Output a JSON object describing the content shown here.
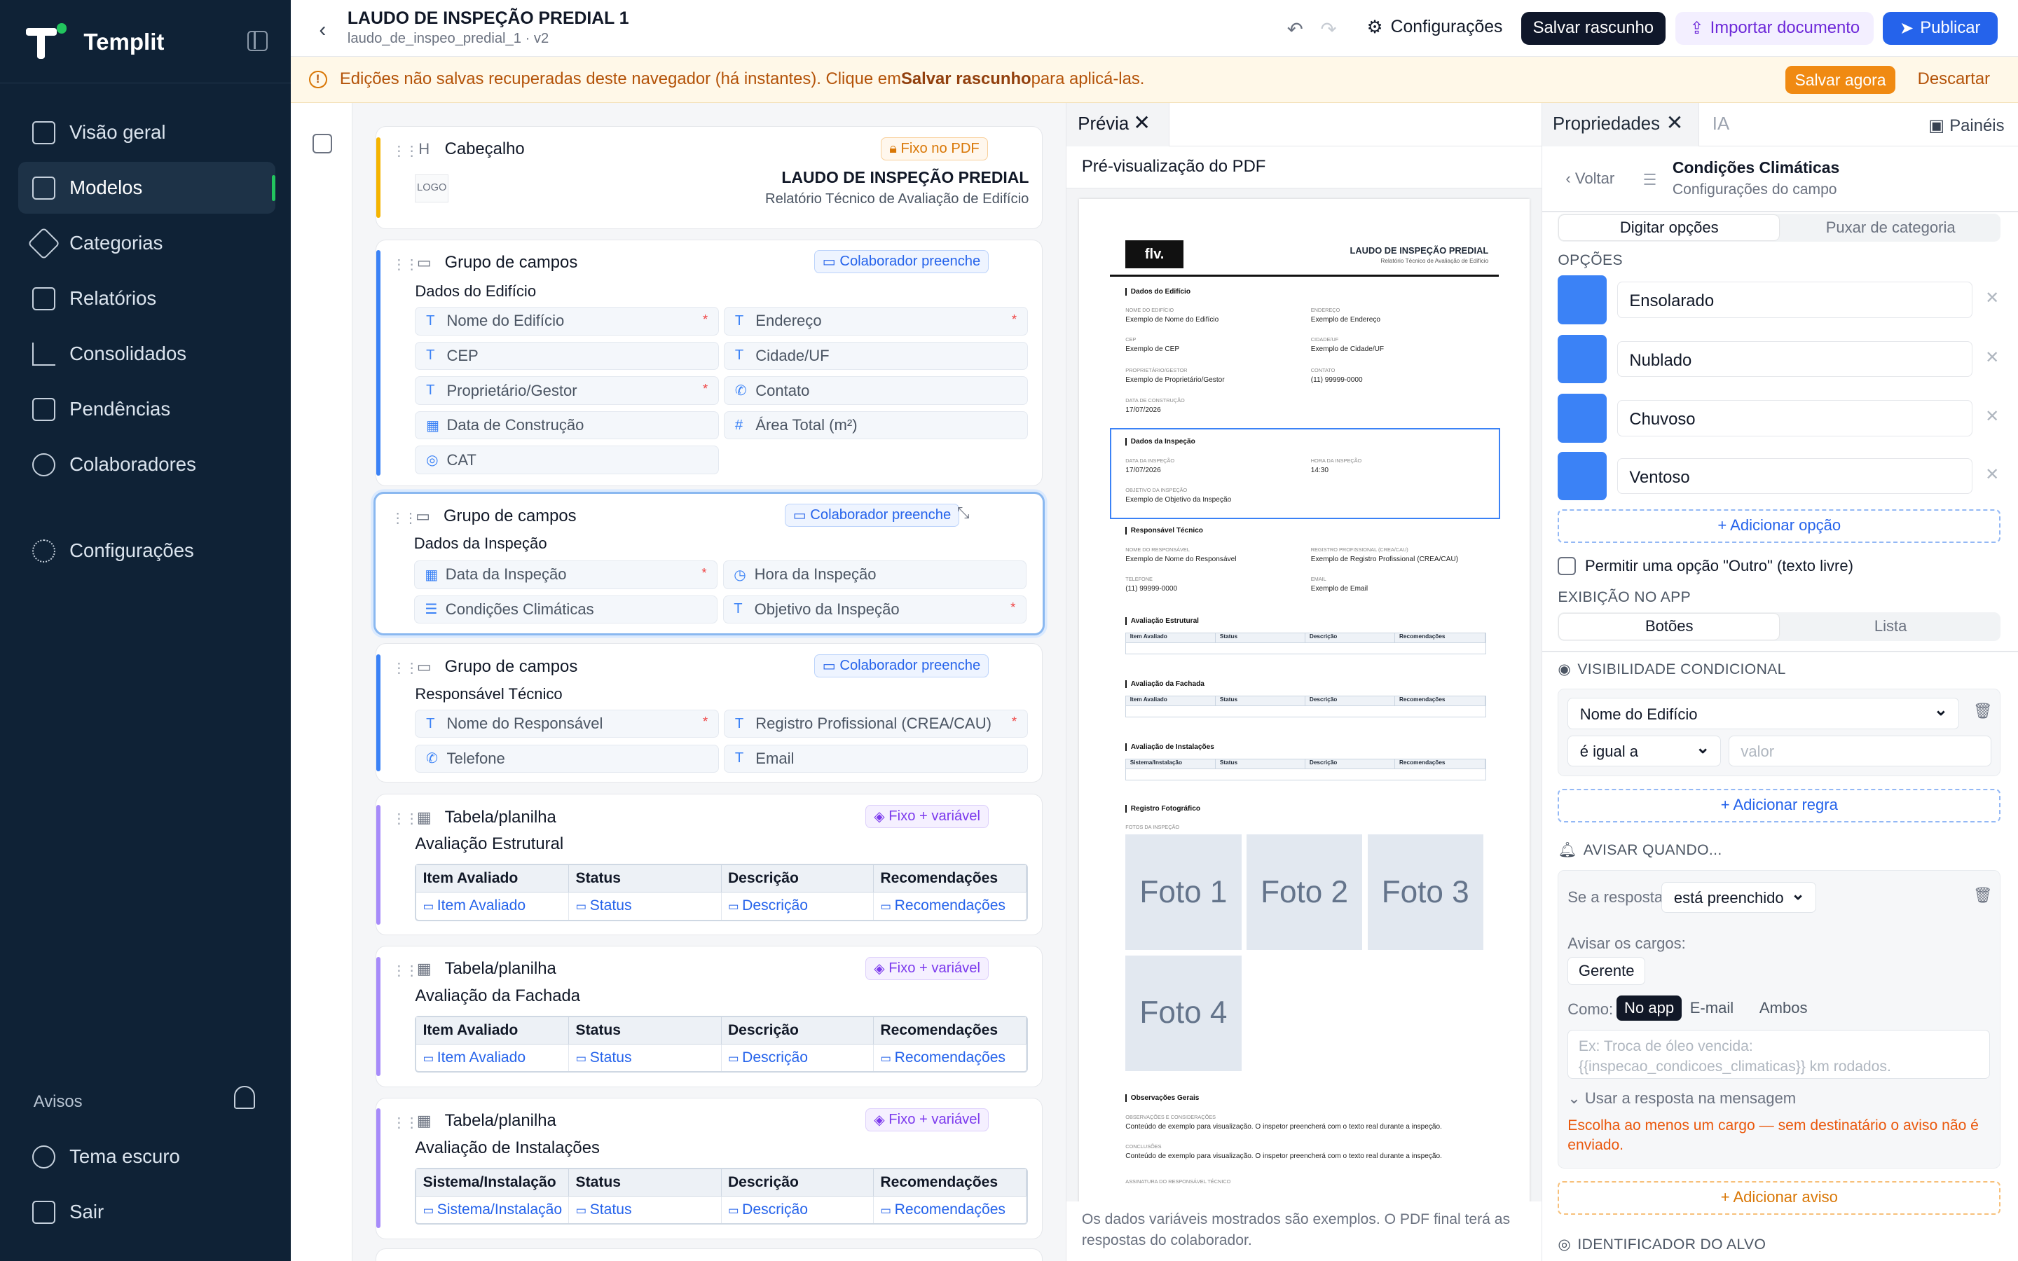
{
  "app": {
    "name": "Templit"
  },
  "sidebar": {
    "items": [
      {
        "label": "Visão geral",
        "icon": "grid-icon"
      },
      {
        "label": "Modelos",
        "icon": "document-icon",
        "active": true
      },
      {
        "label": "Categorias",
        "icon": "tag-icon"
      },
      {
        "label": "Relatórios",
        "icon": "building-icon"
      },
      {
        "label": "Consolidados",
        "icon": "bar-chart-icon"
      },
      {
        "label": "Pendências",
        "icon": "lock-icon"
      },
      {
        "label": "Colaboradores",
        "icon": "users-icon"
      }
    ],
    "settings": "Configurações",
    "notices": "Avisos",
    "dark_theme": "Tema escuro",
    "logout": "Sair"
  },
  "header": {
    "title": "LAUDO DE INSPEÇÃO PREDIAL 1",
    "subtitle": "laudo_de_inspeo_predial_1 · v2",
    "settings": "Configurações",
    "save_draft": "Salvar rascunho",
    "import": "Importar documento",
    "publish": "Publicar"
  },
  "banner": {
    "text1": "Edições não salvas recuperadas deste navegador (há instantes). Clique em ",
    "bold": "Salvar rascunho",
    "text2": " para aplicá-las.",
    "save_now": "Salvar agora",
    "discard": "Descartar"
  },
  "canvas": {
    "header_block": {
      "label": "Cabeçalho",
      "tag": "Fixo no PDF",
      "logo": "LOGO",
      "title": "LAUDO DE INSPEÇÃO PREDIAL",
      "subtitle": "Relatório Técnico de Avaliação de Edifício"
    },
    "groups": [
      {
        "label": "Grupo de campos",
        "tag": "Colaborador preenche",
        "name": "Dados do Edifício",
        "fields": [
          "Nome do Edifício",
          "Endereço",
          "CEP",
          "Cidade/UF",
          "Proprietário/Gestor",
          "Contato",
          "Data de Construção",
          "Área Total (m²)",
          "CAT"
        ]
      },
      {
        "label": "Grupo de campos",
        "tag": "Colaborador preenche",
        "name": "Dados da Inspeção",
        "fields": [
          "Data da Inspeção",
          "Hora da Inspeção",
          "Condições Climáticas",
          "Objetivo da Inspeção"
        ]
      },
      {
        "label": "Grupo de campos",
        "tag": "Colaborador preenche",
        "name": "Responsável Técnico",
        "fields": [
          "Nome do Responsável",
          "Registro Profissional (CREA/CAU)",
          "Telefone",
          "Email"
        ]
      }
    ],
    "tables": [
      {
        "label": "Tabela/planilha",
        "tag": "Fixo + variável",
        "name": "Avaliação Estrutural",
        "headers": [
          "Item Avaliado",
          "Status",
          "Descrição",
          "Recomendações"
        ],
        "cells": [
          "Item Avaliado",
          "Status",
          "Descrição",
          "Recomendações"
        ]
      },
      {
        "label": "Tabela/planilha",
        "tag": "Fixo + variável",
        "name": "Avaliação da Fachada",
        "headers": [
          "Item Avaliado",
          "Status",
          "Descrição",
          "Recomendações"
        ],
        "cells": [
          "Item Avaliado",
          "Status",
          "Descrição",
          "Recomendações"
        ]
      },
      {
        "label": "Tabela/planilha",
        "tag": "Fixo + variável",
        "name": "Avaliação de Instalações",
        "headers": [
          "Sistema/Instalação",
          "Status",
          "Descrição",
          "Recomendações"
        ],
        "cells": [
          "Sistema/Instalação",
          "Status",
          "Descrição",
          "Recomendações"
        ]
      }
    ]
  },
  "preview": {
    "tab": "Prévia",
    "title": "Pré-visualização do PDF",
    "footer": "Os dados variáveis mostrados são exemplos. O PDF final terá as respostas do colaborador.",
    "pdf": {
      "logo": "flv.",
      "title": "LAUDO DE INSPEÇÃO PREDIAL",
      "subtitle": "Relatório Técnico de Avaliação de Edifício",
      "s1": "Dados do Edifício",
      "s2": "Dados da Inspeção",
      "s3": "Responsável Técnico",
      "s4": "Avaliação Estrutural",
      "s5": "Avaliação da Fachada",
      "s6": "Avaliação de Instalações",
      "s7": "Registro Fotográfico",
      "s8": "Observações Gerais",
      "l_nome": "NOME DO EDIFÍCIO",
      "v_nome": "Exemplo de Nome do Edifício",
      "l_end": "ENDEREÇO",
      "v_end": "Exemplo de Endereço",
      "l_cep": "CEP",
      "v_cep": "Exemplo de CEP",
      "l_cid": "CIDADE/UF",
      "v_cid": "Exemplo de Cidade/UF",
      "l_prop": "PROPRIETÁRIO/GESTOR",
      "v_prop": "Exemplo de Proprietário/Gestor",
      "l_cont": "CONTATO",
      "v_cont": "(11) 99999-0000",
      "l_dc": "DATA DE CONSTRUÇÃO",
      "v_dc": "17/07/2026",
      "l_di": "DATA DA INSPEÇÃO",
      "v_di": "17/07/2026",
      "l_hi": "HORA DA INSPEÇÃO",
      "v_hi": "14:30",
      "l_obj": "OBJETIVO DA INSPEÇÃO",
      "v_obj": "Exemplo de Objetivo da Inspeção",
      "l_nr": "NOME DO RESPONSÁVEL",
      "v_nr": "Exemplo de Nome do Responsável",
      "l_reg": "REGISTRO PROFISSIONAL (CREA/CAU)",
      "v_reg": "Exemplo de Registro Profissional (CREA/CAU)",
      "l_tel": "TELEFONE",
      "v_tel": "(11) 99999-0000",
      "l_em": "EMAIL",
      "v_em": "Exemplo de Email",
      "th1": [
        "Item Avaliado",
        "Status",
        "Descrição",
        "Recomendações"
      ],
      "th3": [
        "Sistema/Instalação",
        "Status",
        "Descrição",
        "Recomendações"
      ],
      "fotos_label": "FOTOS DA INSPEÇÃO",
      "fotos": [
        "Foto 1",
        "Foto 2",
        "Foto 3",
        "Foto 4"
      ],
      "l_obs": "OBSERVAÇÕES E CONSIDERAÇÕES",
      "v_obs": "Conteúdo de exemplo para visualização. O inspetor preencherá com o texto real durante a inspeção.",
      "l_conc": "CONCLUSÕES",
      "v_conc": "Conteúdo de exemplo para visualização. O inspetor preencherá com o texto real durante a inspeção.",
      "l_ass": "ASSINATURA DO RESPONSÁVEL TÉCNICO"
    }
  },
  "props": {
    "tab1": "Propriedades",
    "tab2": "IA",
    "panels": "Painéis",
    "back": "Voltar",
    "field_name": "Condições Climáticas",
    "field_sub": "Configurações do campo",
    "seg1": [
      "Digitar opções",
      "Puxar de categoria"
    ],
    "options_label": "OPÇÕES",
    "options": [
      "Ensolarado",
      "Nublado",
      "Chuvoso",
      "Ventoso"
    ],
    "add_option": "+ Adicionar opção",
    "allow_other": "Permitir uma opção \"Outro\" (texto livre)",
    "display_label": "EXIBIÇÃO NO APP",
    "seg2": [
      "Botões",
      "Lista"
    ],
    "cond_label": "VISIBILIDADE CONDICIONAL",
    "cond_field": "Nome do Edifício",
    "cond_op": "é igual a",
    "cond_value_ph": "valor",
    "add_rule": "+ Adicionar regra",
    "notify_label": "AVISAR QUANDO...",
    "if_answer": "Se a resposta",
    "answer_state": "está preenchido",
    "notify_roles": "Avisar os cargos:",
    "role": "Gerente",
    "how": "Como:",
    "how_opts": [
      "No app",
      "E-mail",
      "Ambos"
    ],
    "msg_ph": "Ex: Troca de óleo vencida: {{inspecao_condicoes_climaticas}} km rodados.",
    "use_answer": "Usar a resposta na mensagem",
    "warning": "Escolha ao menos um cargo — sem destinatário o aviso não é enviado.",
    "add_notice": "+ Adicionar aviso",
    "target_label": "IDENTIFICADOR DO ALVO"
  },
  "colors": {
    "sidebar": "#0f2236",
    "accent": "#2563eb",
    "green": "#22c55e",
    "orange": "#f97316"
  }
}
